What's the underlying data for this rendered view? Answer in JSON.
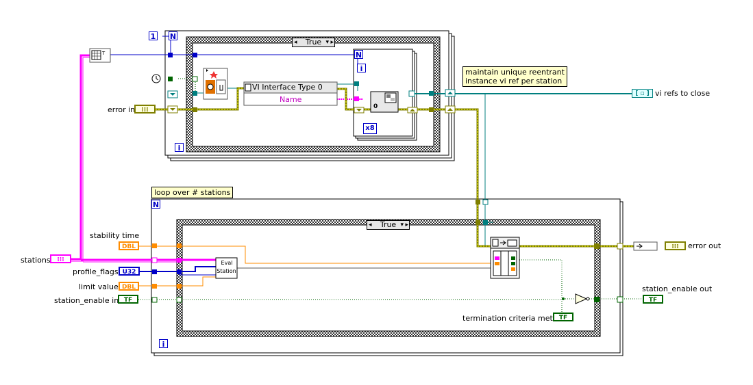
{
  "outer_loops": {
    "top_loop_count_terminal": "N",
    "top_loop_count_constant": "1",
    "iteration_terminal": "i",
    "inner_for_loop_count": "N",
    "inner_for_loop_iteration": "i",
    "bottom_loop_count_terminal": "N",
    "bottom_loop_iteration": "i"
  },
  "case_structures": {
    "top_case_selector": "True",
    "bottom_case_selector": "True"
  },
  "nodes": {
    "vi_interface_label": "VI Interface Type 0",
    "name_property": "Name",
    "open_options_constant": "x8",
    "eval_station_line1": "Eval",
    "eval_station_line2": "Station"
  },
  "comments": {
    "unique_ref_line1": "maintain unique reentrant",
    "unique_ref_line2": "instance vi ref per station",
    "loop_over_stations": "loop over # stations"
  },
  "terminals": {
    "error_in": "error in",
    "vi_refs_to_close": "vi refs to close",
    "stability_time": "stability time",
    "stations": "stations",
    "profile_flags": "profile_flags",
    "limit_value": "limit value",
    "station_enable_in": "station_enable in",
    "error_out": "error out",
    "station_enable_out": "station_enable out",
    "termination_criteria": "termination criteria met?"
  },
  "terminal_types": {
    "dbl": "DBL",
    "u32": "U32",
    "tf": "TF",
    "cluster": "⁞⁞⁞"
  },
  "colors": {
    "error_wire": "#7f7f00",
    "refnum_wire": "#007f7f",
    "cluster_wire": "#ff00ff",
    "int_wire": "#0000c8",
    "dbl_wire": "#ff8c00",
    "bool_wire": "#006400"
  }
}
